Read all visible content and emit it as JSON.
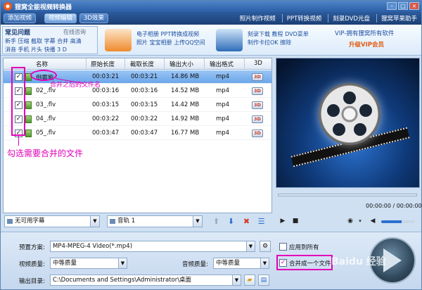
{
  "window": {
    "title": "狸窝全能视频转换器"
  },
  "tabs": [
    {
      "label": "添加视频"
    },
    {
      "label": "视频编辑"
    },
    {
      "label": "3D效果"
    }
  ],
  "top_links": [
    "照片制作视频",
    "PPT转换视频",
    "刻录DVD光盘",
    "狸窝苹果助手"
  ],
  "faq": {
    "title": "常见问题",
    "online": "在线咨询",
    "row1": "新手 压缩 截取 字幕 合并 高清",
    "row2": "消音 手机 片头 快播 3 D"
  },
  "promos": {
    "p1_line1": "电子相册 PPT转换成视频",
    "p1_line2": "照片 宝宝相册 上传QQ空间",
    "p2_line1": "刻录下载 教程 DVD菜单",
    "p2_line2": "制作卡拉OK 擦除",
    "vip_line1": "VIP-拥有狸窝所有软件",
    "vip_line2": "升级VIP会员"
  },
  "list": {
    "headers": {
      "name": "名称",
      "orig": "原始长度",
      "cut": "截取长度",
      "size": "输出大小",
      "format": "输出格式",
      "three_d": "3D"
    },
    "rows": [
      {
        "name": "倒霉熊",
        "orig": "00:03:21",
        "cut": "00:03:21",
        "size": "14.86 MB",
        "format": "mp4",
        "checked": "✓",
        "badge": "3D"
      },
      {
        "name": "02_.flv",
        "orig": "00:03:16",
        "cut": "00:03:16",
        "size": "14.52 MB",
        "format": "mp4",
        "checked": "✓",
        "badge": "3D"
      },
      {
        "name": "03_.flv",
        "orig": "00:03:15",
        "cut": "00:03:15",
        "size": "14.42 MB",
        "format": "mp4",
        "checked": "✓",
        "badge": "3D"
      },
      {
        "name": "04_.flv",
        "orig": "00:03:22",
        "cut": "00:03:22",
        "size": "14.92 MB",
        "format": "mp4",
        "checked": "✓",
        "badge": "3D"
      },
      {
        "name": "05_.flv",
        "orig": "00:03:47",
        "cut": "00:03:47",
        "size": "16.77 MB",
        "format": "mp4",
        "checked": "✓",
        "badge": "3D"
      }
    ]
  },
  "annotations": {
    "merged_name": "合并之后的文件名",
    "select_files": "勾选需要合并的文件"
  },
  "player": {
    "time": "00:00:00 / 00:00:00"
  },
  "tracks": {
    "subtitle": "无可用字幕",
    "audio": "音轨 1"
  },
  "settings": {
    "preset_label": "预置方案:",
    "preset_value": "MP4-MPEG-4 Video(*.mp4)",
    "apply_all": "应用到所有",
    "video_quality_label": "视频质量:",
    "video_quality_value": "中等质量",
    "audio_quality_label": "音频质量:",
    "audio_quality_value": "中等质量",
    "merge_label": "合并成一个文件",
    "output_label": "输出目录:",
    "output_value": "C:\\Documents and Settings\\Administrator\\桌面"
  },
  "watermark": "Baidu 经验",
  "colors": {
    "accent": "#2a5fa6",
    "annotation": "#e200b8",
    "selected_row": "#6aa6ea"
  }
}
